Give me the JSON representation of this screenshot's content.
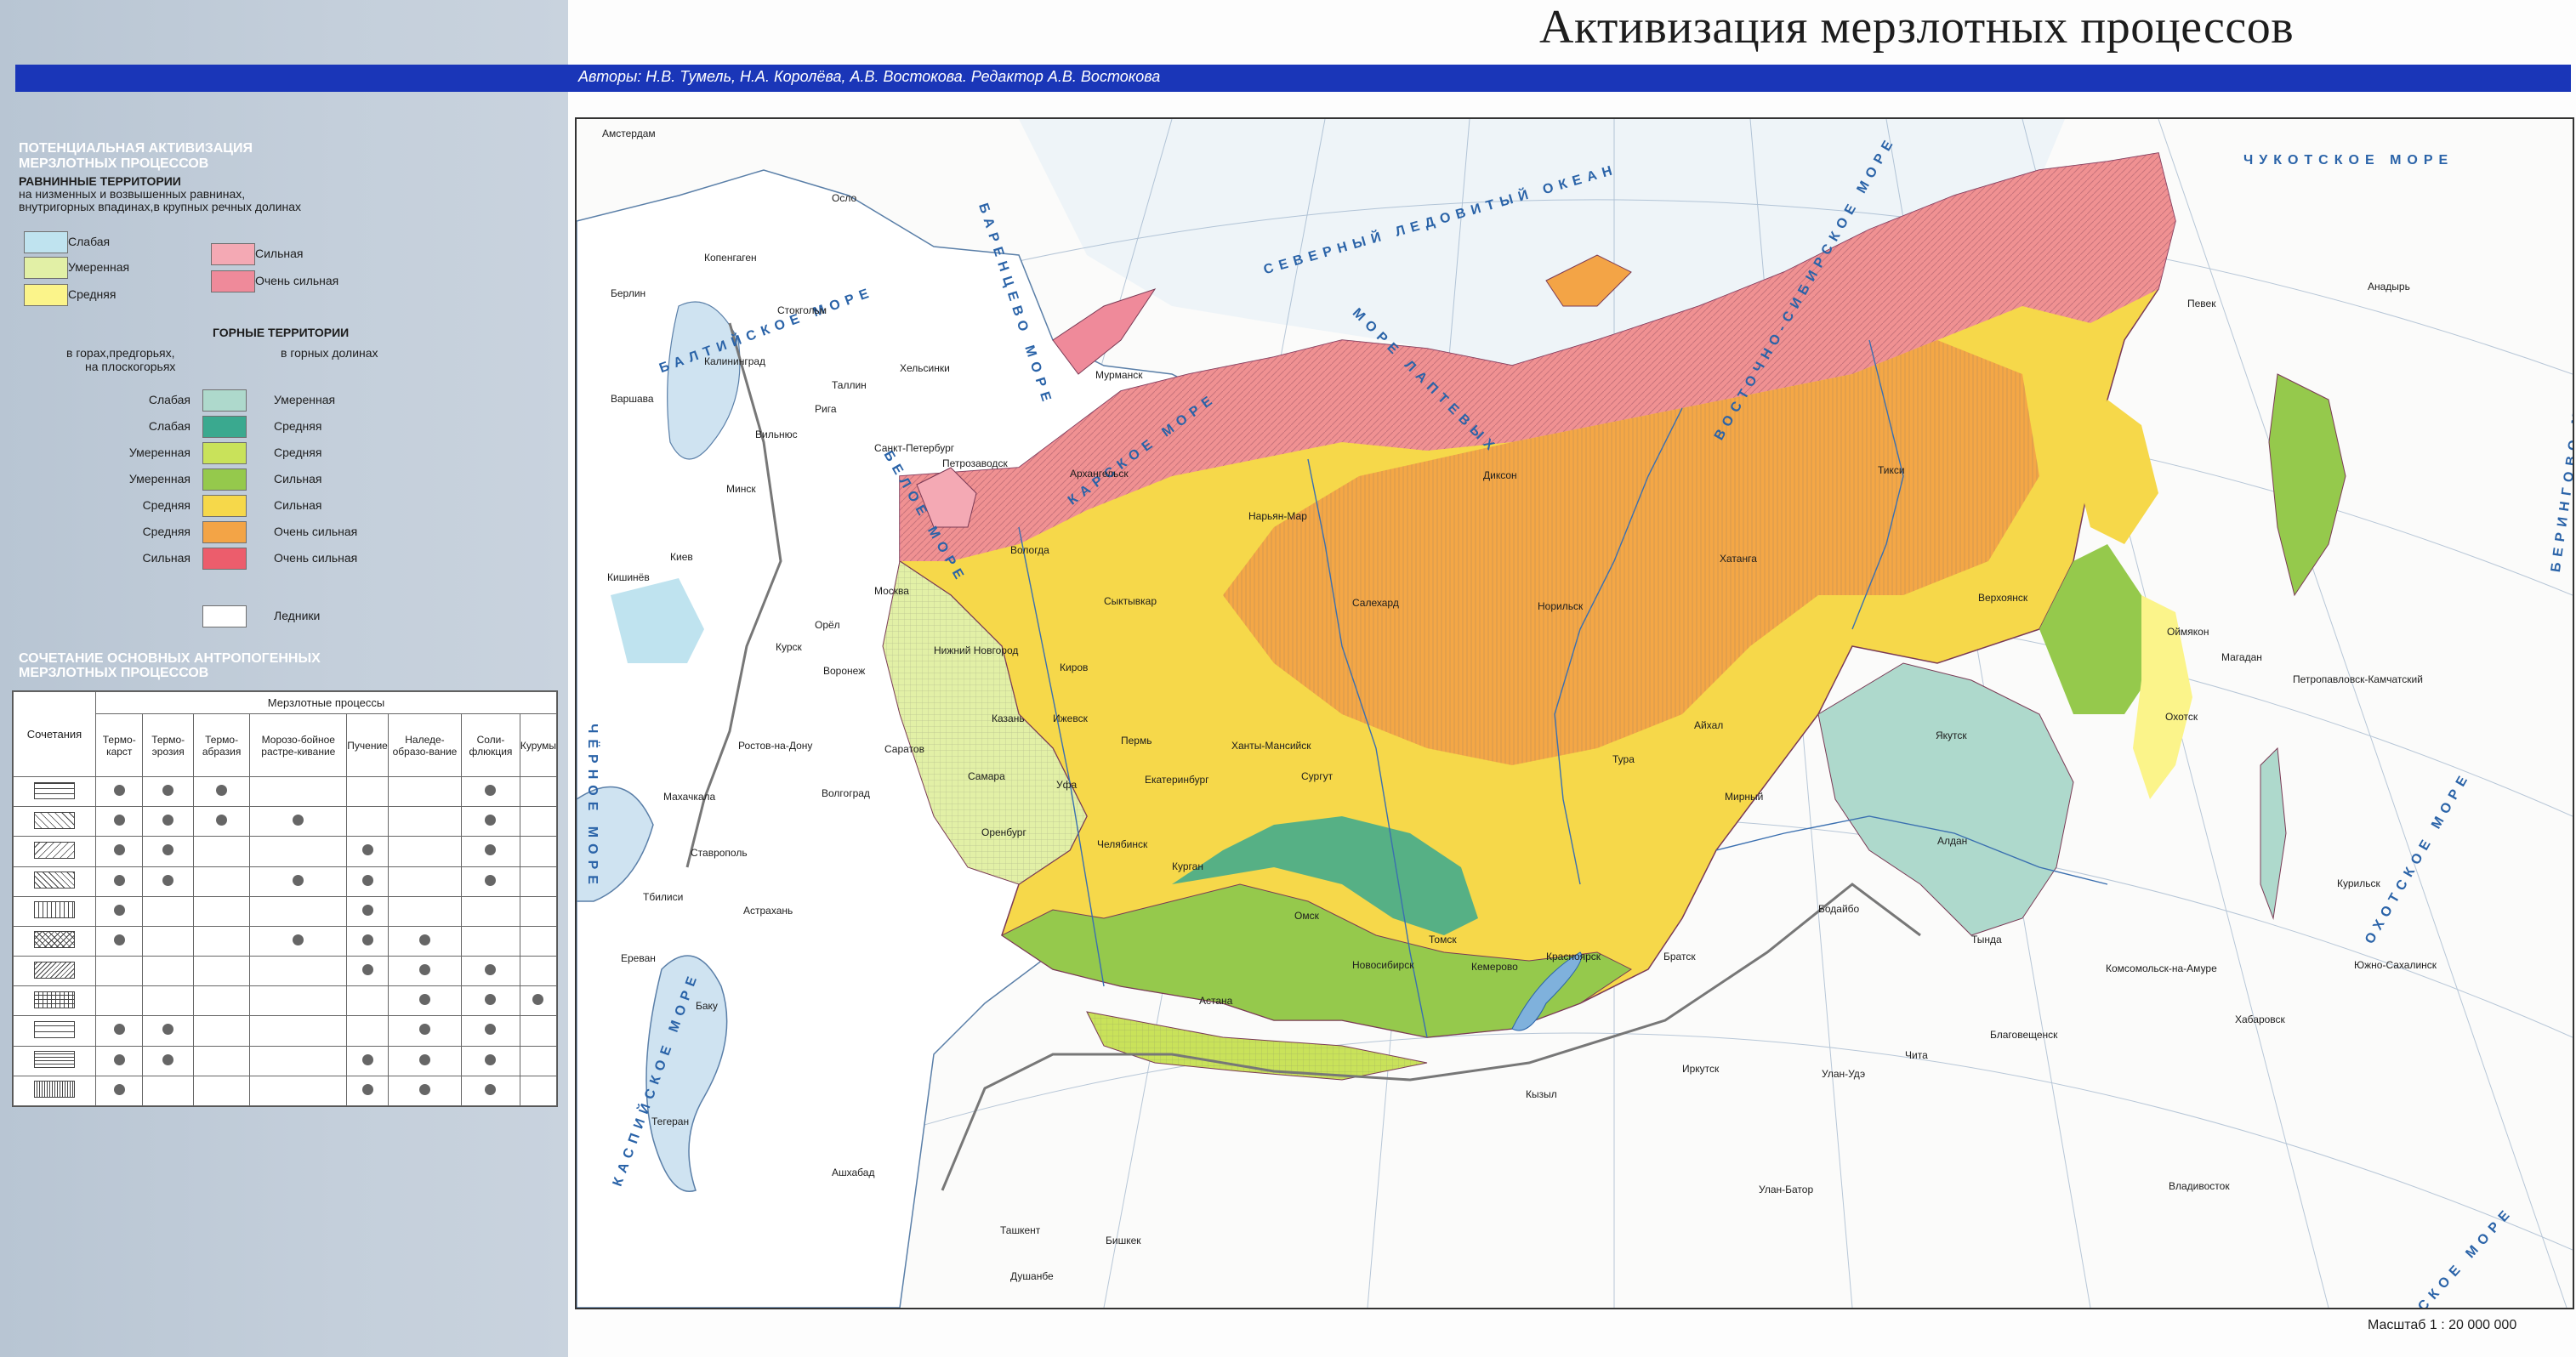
{
  "title": "Активизация мерзлотных процессов",
  "authors": "Авторы: Н.В. Тумель, Н.А. Королёва, А.В. Востокова. Редактор А.В. Востокова",
  "scale": "Масштаб 1 : 20 000 000",
  "legend": {
    "section1_title_line1": "ПОТЕНЦИАЛЬНАЯ АКТИВИЗАЦИЯ",
    "section1_title_line2": "МЕРЗЛОТНЫХ ПРОЦЕССОВ",
    "plain_title": "РАВНИННЫЕ ТЕРРИТОРИИ",
    "plain_sub_line1": "на низменных и возвышенных равнинах,",
    "plain_sub_line2": "внутригорных впадинах,в крупных речных долинах",
    "plain_items": [
      {
        "label": "Слабая",
        "color": "#bfe3ef"
      },
      {
        "label": "Умеренная",
        "color": "#e2f0a6"
      },
      {
        "label": "Средняя",
        "color": "#fbf48a"
      },
      {
        "label": "Сильная",
        "color": "#f4a9b4"
      },
      {
        "label": "Очень сильная",
        "color": "#ef8a9a"
      }
    ],
    "mountain_title": "ГОРНЫЕ ТЕРРИТОРИИ",
    "mountain_left_head_line1": "в горах,предгорьях,",
    "mountain_left_head_line2": "на плоскогорьях",
    "mountain_right_head": "в горных долинах",
    "mountain_left_items": [
      "Слабая",
      "Слабая",
      "Умеренная",
      "Умеренная",
      "Средняя",
      "Средняя",
      "Сильная"
    ],
    "mountain_items": [
      {
        "label": "Умеренная",
        "color": "#aed9cc"
      },
      {
        "label": "Средняя",
        "color": "#3aa98f"
      },
      {
        "label": "Средняя",
        "color": "#c9e25a"
      },
      {
        "label": "Сильная",
        "color": "#95c94c"
      },
      {
        "label": "Сильная",
        "color": "#f6d84a"
      },
      {
        "label": "Очень сильная",
        "color": "#f3a446"
      },
      {
        "label": "Очень сильная",
        "color": "#ec5d6c"
      }
    ],
    "glaciers_label": "Ледники",
    "section2_title_line1": "СОЧЕТАНИЕ ОСНОВНЫХ АНТРОПОГЕННЫХ",
    "section2_title_line2": "МЕРЗЛОТНЫХ ПРОЦЕССОВ"
  },
  "combo_table": {
    "col_first": "Сочетания",
    "group_header": "Мерзлотные процессы",
    "columns": [
      "Термо-карст",
      "Термо-эрозия",
      "Термо-абразия",
      "Морозо-бойное растре-кивание",
      "Пучение",
      "Наледе-образо-вание",
      "Соли-флюкция",
      "Курумы"
    ],
    "rows": [
      [
        1,
        1,
        1,
        0,
        0,
        0,
        1,
        0
      ],
      [
        1,
        1,
        1,
        1,
        0,
        0,
        1,
        0
      ],
      [
        1,
        1,
        0,
        0,
        1,
        0,
        1,
        0
      ],
      [
        1,
        1,
        0,
        1,
        1,
        0,
        1,
        0
      ],
      [
        1,
        0,
        0,
        0,
        1,
        0,
        0,
        0
      ],
      [
        1,
        0,
        0,
        1,
        1,
        1,
        0,
        0
      ],
      [
        0,
        0,
        0,
        0,
        1,
        1,
        1,
        0
      ],
      [
        0,
        0,
        0,
        0,
        0,
        1,
        1,
        1
      ],
      [
        1,
        1,
        0,
        0,
        0,
        1,
        1,
        0
      ],
      [
        1,
        1,
        0,
        0,
        1,
        1,
        1,
        0
      ],
      [
        1,
        0,
        0,
        0,
        1,
        1,
        1,
        0
      ]
    ]
  },
  "map": {
    "seas": [
      "СЕВЕРНЫЙ ЛЕДОВИТЫЙ ОКЕАН",
      "БАРЕНЦЕВО МОРЕ",
      "КАРСКОЕ МОРЕ",
      "МОРЕ ЛАПТЕВЫХ",
      "ВОСТОЧНО-СИБИРСКОЕ МОРЕ",
      "ЧУКОТСКОЕ МОРЕ",
      "БЕРИНГОВО МОРЕ",
      "ОХОТСКОЕ МОРЕ",
      "ЯПОНСКОЕ МОРЕ",
      "КАСПИЙСКОЕ МОРЕ",
      "ЧЁРНОЕ МОРЕ",
      "БАЛТИЙСКОЕ МОРЕ",
      "БЕЛОЕ МОРЕ"
    ],
    "cities": [
      "Амстердам",
      "Осло",
      "Копенгаген",
      "Берлин",
      "Стокгольм",
      "Хельсинки",
      "Таллин",
      "Рига",
      "Вильнюс",
      "Калининград",
      "Варшава",
      "Минск",
      "Киев",
      "Кишинёв",
      "Мурманск",
      "Петрозаводск",
      "Архангельск",
      "Санкт-Петербург",
      "Вологда",
      "Москва",
      "Орёл",
      "Курск",
      "Воронеж",
      "Нижний Новгород",
      "Сыктывкар",
      "Киров",
      "Казань",
      "Ижевск",
      "Пермь",
      "Самара",
      "Саратов",
      "Уфа",
      "Екатеринбург",
      "Челябинск",
      "Оренбург",
      "Ростов-на-Дону",
      "Волгоград",
      "Махачкала",
      "Ставрополь",
      "Астрахань",
      "Тбилиси",
      "Ереван",
      "Баку",
      "Тегеран",
      "Ашхабад",
      "Ташкент",
      "Бишкек",
      "Душанбе",
      "Астана",
      "Курган",
      "Омск",
      "Новосибирск",
      "Томск",
      "Кемерово",
      "Красноярск",
      "Братск",
      "Иркутск",
      "Кызыл",
      "Улан-Удэ",
      "Улан-Батор",
      "Чита",
      "Бодайбо",
      "Мирный",
      "Тура",
      "Айхал",
      "Норильск",
      "Хатанга",
      "Диксон",
      "Салехард",
      "Нарьян-Мар",
      "Ханты-Мансийск",
      "Сургут",
      "Тикси",
      "Верхоянск",
      "Якутск",
      "Алдан",
      "Тында",
      "Благовещенск",
      "Хабаровск",
      "Комсомольск-на-Амуре",
      "Владивосток",
      "Южно-Сахалинск",
      "Оймякон",
      "Магадан",
      "Охотск",
      "Певек",
      "Анадырь",
      "Петропавловск-Камчатский",
      "Курильск"
    ]
  }
}
